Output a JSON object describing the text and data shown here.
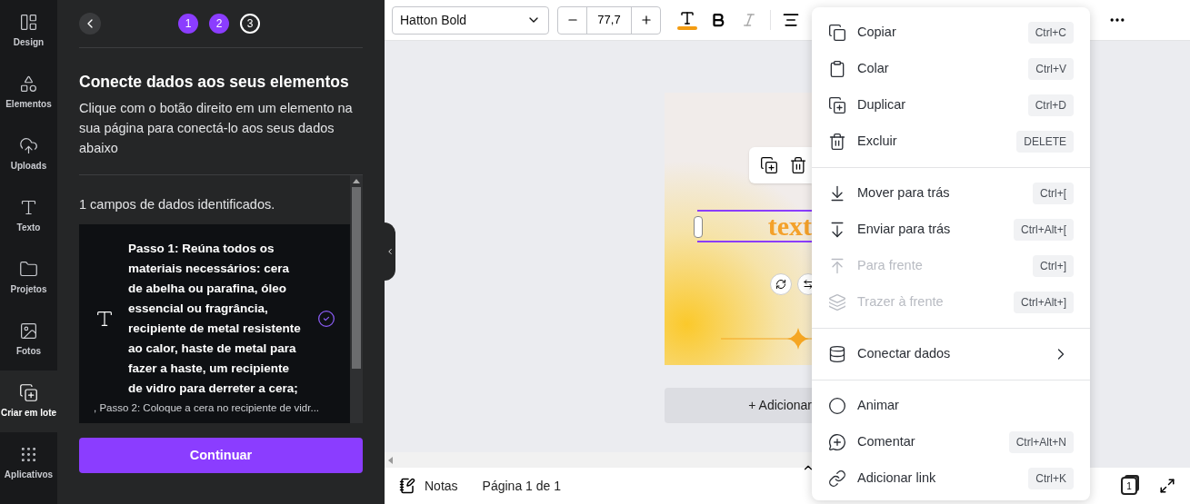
{
  "rail": {
    "items": [
      {
        "label": "Design",
        "selected": false
      },
      {
        "label": "Elementos",
        "selected": false
      },
      {
        "label": "Uploads",
        "selected": false
      },
      {
        "label": "Texto",
        "selected": false
      },
      {
        "label": "Projetos",
        "selected": false
      },
      {
        "label": "Fotos",
        "selected": false
      },
      {
        "label": "Criar em lote",
        "selected": true
      },
      {
        "label": "Aplicativos",
        "selected": false
      }
    ]
  },
  "panel": {
    "steps": [
      {
        "label": "1",
        "completed": true
      },
      {
        "label": "2",
        "completed": true
      },
      {
        "label": "3",
        "completed": false
      }
    ],
    "heading": "Conecte dados aos seus elementos",
    "description": "Clique com o botão direito em um elemento na sua página para conectá-lo aos seus dados abaixo",
    "fields_count": "1 campos de dados identificados.",
    "field_card": {
      "text": "Passo 1: Reúna todos os materiais necessários: cera de abelha ou parafina, óleo essencial ou fragrância, recipiente de metal resistente ao calor, haste de metal para fazer a haste, um recipiente de vidro para derreter a cera;",
      "checked": true,
      "next_line": ", Passo 2: Coloque a cera no recipiente de vidr..."
    },
    "continue_button": "Continuar"
  },
  "toolbar": {
    "font": "Hatton Bold",
    "font_size": "77,7",
    "italic_disabled": true
  },
  "canvas": {
    "page_text": "text",
    "add_page_button": "+ Adicionar"
  },
  "bottom_bar": {
    "notes": "Notas",
    "page_indicator": "Página 1 de 1",
    "page_count": "1"
  },
  "context_menu": {
    "sections": [
      [
        {
          "label": "Copiar",
          "shortcut": "Ctrl+C",
          "disabled": false,
          "kind": "item"
        },
        {
          "label": "Colar",
          "shortcut": "Ctrl+V",
          "disabled": false,
          "kind": "item"
        },
        {
          "label": "Duplicar",
          "shortcut": "Ctrl+D",
          "disabled": false,
          "kind": "item"
        },
        {
          "label": "Excluir",
          "shortcut": "DELETE",
          "disabled": false,
          "kind": "item"
        }
      ],
      [
        {
          "label": "Mover para trás",
          "shortcut": "Ctrl+[",
          "disabled": false,
          "kind": "item"
        },
        {
          "label": "Enviar para trás",
          "shortcut": "Ctrl+Alt+[",
          "disabled": false,
          "kind": "item"
        },
        {
          "label": "Para frente",
          "shortcut": "Ctrl+]",
          "disabled": true,
          "kind": "item"
        },
        {
          "label": "Trazer à frente",
          "shortcut": "Ctrl+Alt+]",
          "disabled": true,
          "kind": "item"
        }
      ],
      [
        {
          "label": "Conectar dados",
          "disabled": false,
          "kind": "submenu"
        }
      ],
      [
        {
          "label": "Animar",
          "disabled": false,
          "kind": "item"
        },
        {
          "label": "Comentar",
          "shortcut": "Ctrl+Alt+N",
          "disabled": false,
          "kind": "item"
        },
        {
          "label": "Adicionar link",
          "shortcut": "Ctrl+K",
          "disabled": false,
          "kind": "item"
        }
      ]
    ]
  }
}
